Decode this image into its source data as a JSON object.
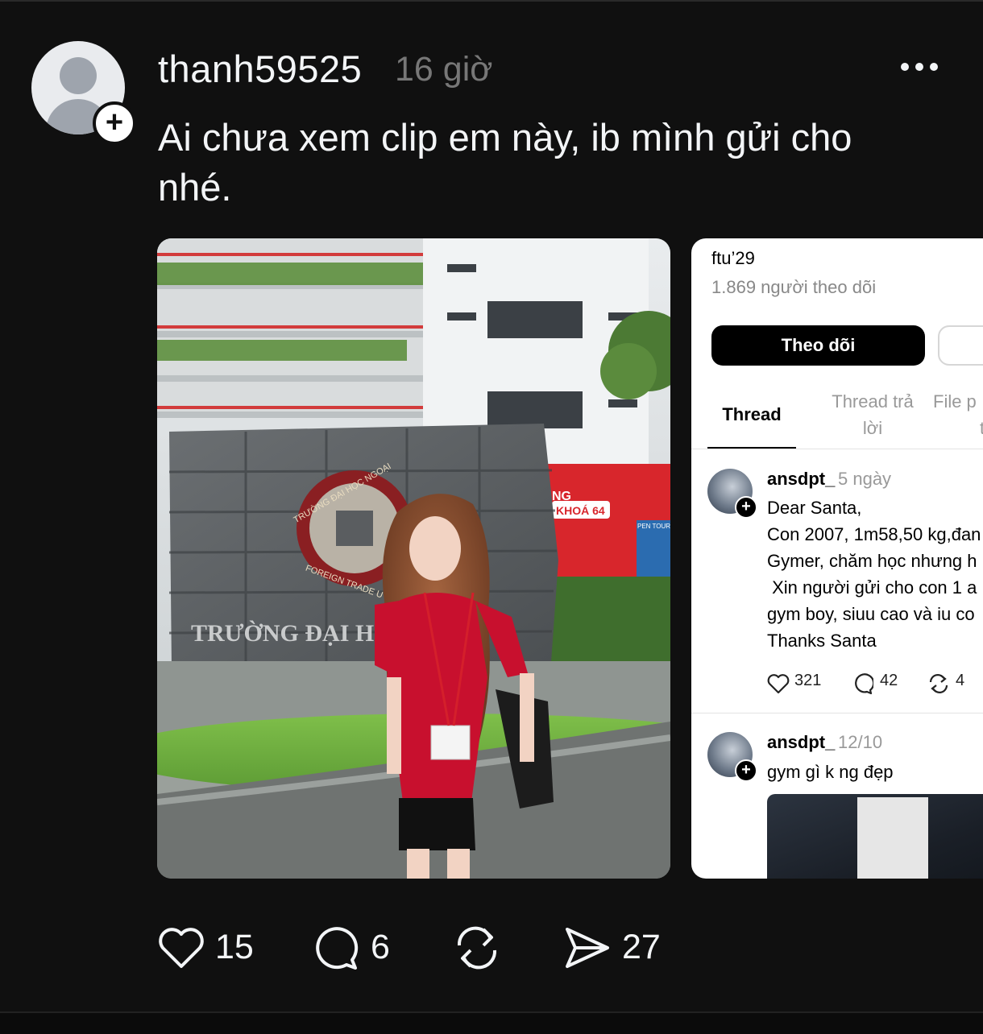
{
  "post": {
    "username": "thanh59525",
    "time": "16 giờ",
    "caption": "Ai chưa xem clip em này, ib mình gửi cho nhé."
  },
  "photo1": {
    "sign_text": "TRƯỜNG ĐẠI HỌC N",
    "seal_top": "TRƯỜNG ĐẠI HỌC NGOẠI",
    "seal_bottom": "FOREIGN TRADE U",
    "banner_text_1": "NG",
    "banner_text_2": "KHOÁ 64",
    "banner_small": "PEN TOUR"
  },
  "screenshot": {
    "bio": "ftu’29",
    "followers": "1.869 người theo dõi",
    "follow_button": "Theo dõi",
    "tabs": [
      "Thread",
      "Thread trả lời",
      "File p t"
    ],
    "tab2_lines": [
      "Thread trả",
      "lời"
    ],
    "tab3_lines": [
      "File p",
      "t"
    ],
    "comments": [
      {
        "user": "ansdpt_",
        "time": "5 ngày",
        "lines": [
          "Dear Santa,",
          "Con 2007, 1m58,50 kg,đan",
          "Gymer, chăm học nhưng h",
          " Xin người gửi cho con 1 a",
          "gym boy, siuu cao và iu co",
          "Thanks Santa"
        ],
        "likes": "321",
        "replies": "42",
        "reposts": "4"
      },
      {
        "user": "ansdpt_",
        "time": "12/10",
        "lines": [
          "gym gì k ng đẹp"
        ]
      }
    ]
  },
  "actions": {
    "likes": "15",
    "comments": "6",
    "shares": "27"
  },
  "colors": {
    "background": "#101010",
    "text": "#f3f5f7",
    "muted": "#777777",
    "shirt_red": "#c8102e"
  }
}
